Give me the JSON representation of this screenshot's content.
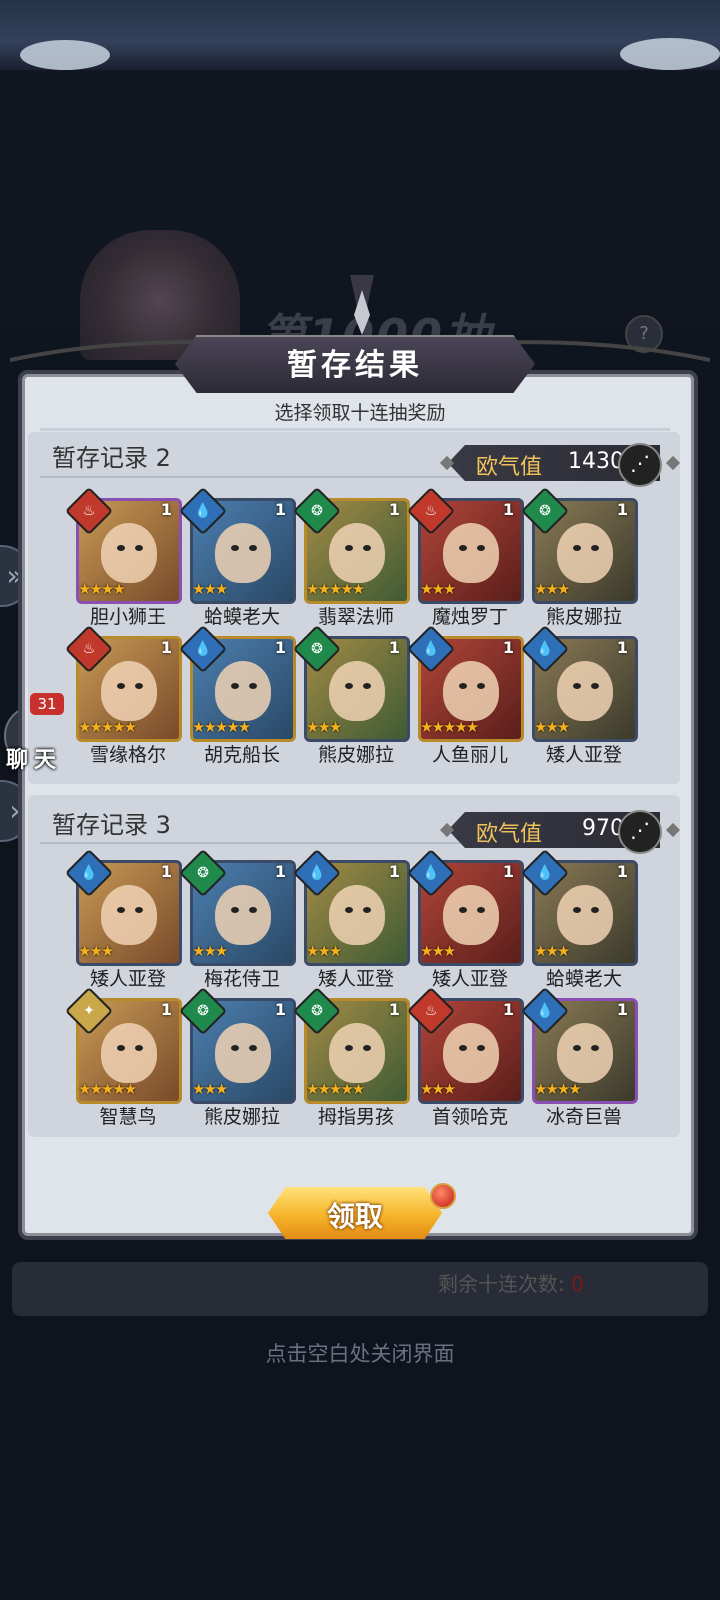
{
  "popup": {
    "title": "暂存结果",
    "subtitle": "选择领取十连抽奖励",
    "claim_label": "领取",
    "remaining_label": "剩余十连次数:",
    "remaining_value": "0",
    "close_hint": "点击空白处关闭界面"
  },
  "background": {
    "banner_text": "第1000抽",
    "help_icon": "?"
  },
  "chat": {
    "label": "聊天",
    "badge": "31"
  },
  "records": [
    {
      "title": "暂存记录 2",
      "luck_label": "欧气值",
      "luck_value": "1430",
      "heroes": [
        {
          "name": "胆小狮王",
          "element": "fire",
          "stars": 4,
          "count": "1"
        },
        {
          "name": "蛤蟆老大",
          "element": "water",
          "stars": 3,
          "count": "1"
        },
        {
          "name": "翡翠法师",
          "element": "wind",
          "stars": 5,
          "count": "1"
        },
        {
          "name": "魔烛罗丁",
          "element": "fire",
          "stars": 3,
          "count": "1"
        },
        {
          "name": "熊皮娜拉",
          "element": "wind",
          "stars": 3,
          "count": "1"
        },
        {
          "name": "雪缘格尔",
          "element": "fire",
          "stars": 5,
          "count": "1"
        },
        {
          "name": "胡克船长",
          "element": "water",
          "stars": 5,
          "count": "1"
        },
        {
          "name": "熊皮娜拉",
          "element": "wind",
          "stars": 3,
          "count": "1"
        },
        {
          "name": "人鱼丽儿",
          "element": "water",
          "stars": 5,
          "count": "1"
        },
        {
          "name": "矮人亚登",
          "element": "water",
          "stars": 3,
          "count": "1"
        }
      ]
    },
    {
      "title": "暂存记录 3",
      "luck_label": "欧气值",
      "luck_value": "970",
      "heroes": [
        {
          "name": "矮人亚登",
          "element": "water",
          "stars": 3,
          "count": "1"
        },
        {
          "name": "梅花侍卫",
          "element": "wind",
          "stars": 3,
          "count": "1"
        },
        {
          "name": "矮人亚登",
          "element": "water",
          "stars": 3,
          "count": "1"
        },
        {
          "name": "矮人亚登",
          "element": "water",
          "stars": 3,
          "count": "1"
        },
        {
          "name": "蛤蟆老大",
          "element": "water",
          "stars": 3,
          "count": "1"
        },
        {
          "name": "智慧鸟",
          "element": "light",
          "stars": 5,
          "count": "1"
        },
        {
          "name": "熊皮娜拉",
          "element": "wind",
          "stars": 3,
          "count": "1"
        },
        {
          "name": "拇指男孩",
          "element": "wind",
          "stars": 5,
          "count": "1"
        },
        {
          "name": "首领哈克",
          "element": "fire",
          "stars": 3,
          "count": "1"
        },
        {
          "name": "冰奇巨兽",
          "element": "water",
          "stars": 4,
          "count": "1"
        }
      ]
    }
  ],
  "colors": {
    "fire": "#c0392b",
    "water": "#2f6fb8",
    "wind": "#1f8a4c",
    "light": "#c9a84a",
    "gold_frame": "#b88a2a",
    "purple_frame": "#8a4fb3"
  }
}
